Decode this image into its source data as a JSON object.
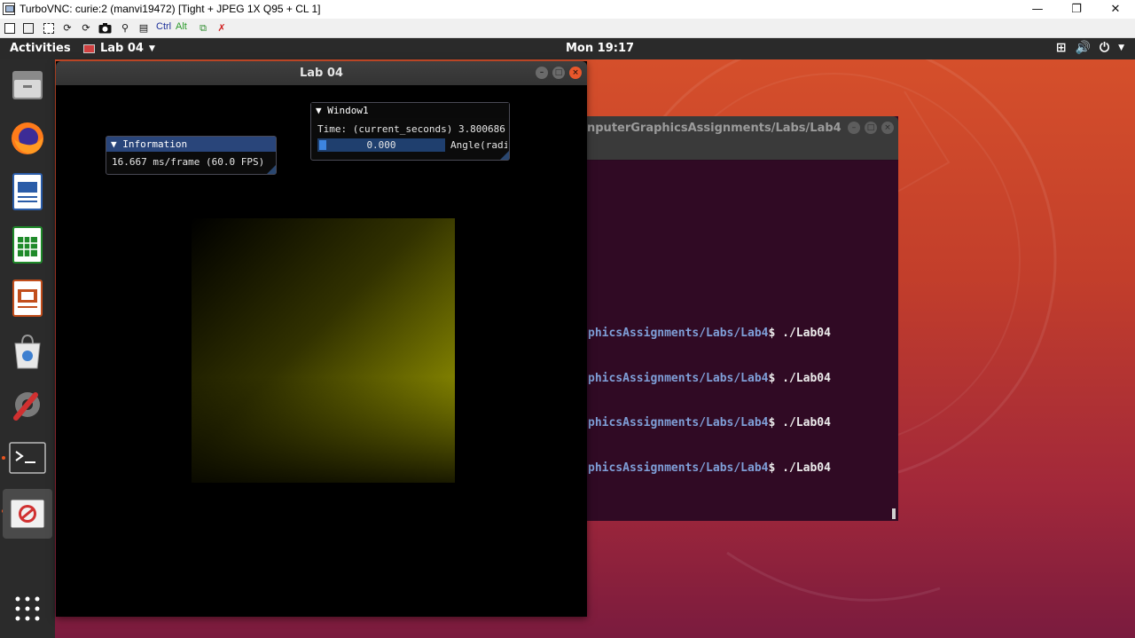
{
  "vnc": {
    "title": "TurboVNC: curie:2 (manvi19472) [Tight + JPEG 1X Q95 + CL 1]",
    "controls": {
      "minimize": "—",
      "restore": "❐",
      "close": "✕"
    },
    "toolbar": {
      "ctrl_label": "Ctrl",
      "alt_label": "Alt"
    }
  },
  "topbar": {
    "activities": "Activities",
    "app_menu": "Lab 04",
    "clock": "Mon 19:17"
  },
  "dock": {
    "items": [
      "files-icon",
      "firefox-icon",
      "writer-icon",
      "calc-icon",
      "impress-icon",
      "software-icon",
      "settings-icon",
      "terminal-icon",
      "lab04-icon",
      "show-apps-icon"
    ]
  },
  "lab_window": {
    "title": "Lab 04",
    "info_panel": {
      "title": "▼ Information",
      "text": "16.667 ms/frame (60.0 FPS)"
    },
    "window1_panel": {
      "title": "▼ Window1",
      "time_text": "Time: (current_seconds) 3.800686",
      "slider_value": "0.000",
      "slider_label": "Angle(radi"
    }
  },
  "terminal": {
    "title": "nputerGraphicsAssignments/Labs/Lab4",
    "lines": [
      {
        "path": "phicsAssignments/Labs/Lab4",
        "cmd": "$ ./Lab04"
      },
      {
        "path": "phicsAssignments/Labs/Lab4",
        "cmd": "$ ./Lab04"
      },
      {
        "path": "phicsAssignments/Labs/Lab4",
        "cmd": "$ ./Lab04"
      },
      {
        "path": "phicsAssignments/Labs/Lab4",
        "cmd": "$ ./Lab04"
      }
    ]
  },
  "colors": {
    "accent": "#e95420",
    "terminal_bg": "#300a24",
    "imgui_title_active": "#29457a"
  }
}
